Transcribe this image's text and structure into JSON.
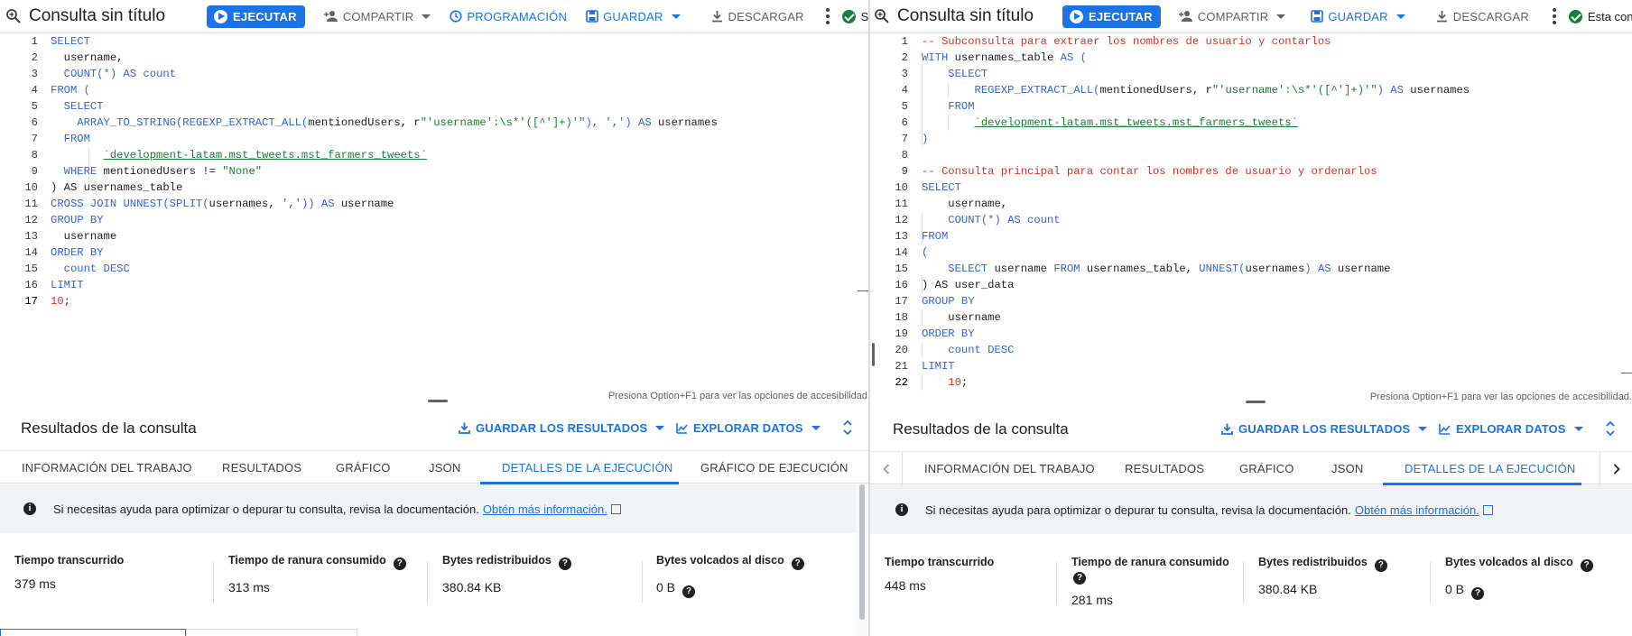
{
  "left": {
    "toolbar": {
      "title": "Consulta sin título",
      "run_label": "EJECUTAR",
      "share_label": "COMPARTIR",
      "schedule_label": "PROGRAMACIÓN",
      "save_label": "GUARDAR",
      "download_label": "DESCARGAR",
      "status_label": "Se c..."
    },
    "line_numbers": [
      "1",
      "2",
      "3",
      "4",
      "5",
      "6",
      "7",
      "8",
      "9",
      "10",
      "11",
      "12",
      "13",
      "14",
      "15",
      "16",
      "17"
    ],
    "accessibility_hint": "Presiona Option+F1 para ver las opciones de accesibilidad.",
    "results": {
      "title": "Resultados de la consulta",
      "save_results_label": "GUARDAR LOS RESULTADOS",
      "explore_label": "EXPLORAR DATOS",
      "tabs": [
        "INFORMACIÓN DEL TRABAJO",
        "RESULTADOS",
        "GRÁFICO",
        "JSON",
        "DETALLES DE LA EJECUCIÓN",
        "GRÁFICO DE EJECUCIÓN"
      ],
      "active_tab": "DETALLES DE LA EJECUCIÓN",
      "info_text": "Si necesitas ayuda para optimizar o depurar tu consulta, revisa la documentación.",
      "info_link": "Obtén más información.",
      "metrics": [
        {
          "label": "Tiempo transcurrido",
          "value": "379 ms"
        },
        {
          "label": "Tiempo de ranura consumido",
          "value": "313 ms"
        },
        {
          "label": "Bytes redistribuidos",
          "value": "380.84 KB"
        },
        {
          "label": "Bytes volcados al disco",
          "value": "0 B"
        }
      ]
    }
  },
  "right": {
    "toolbar": {
      "title": "Consulta sin título",
      "run_label": "EJECUTAR",
      "share_label": "COMPARTIR",
      "save_label": "GUARDAR",
      "download_label": "DESCARGAR",
      "status_label": "Esta con..."
    },
    "line_numbers": [
      "1",
      "2",
      "3",
      "4",
      "5",
      "6",
      "7",
      "8",
      "9",
      "10",
      "11",
      "12",
      "13",
      "14",
      "15",
      "16",
      "17",
      "18",
      "19",
      "20",
      "21",
      "22"
    ],
    "accessibility_hint": "Presiona Option+F1 para ver las opciones de accesibilidad.",
    "results": {
      "title": "Resultados de la consulta",
      "save_results_label": "GUARDAR LOS RESULTADOS",
      "explore_label": "EXPLORAR DATOS",
      "tabs": [
        "INFORMACIÓN DEL TRABAJO",
        "RESULTADOS",
        "GRÁFICO",
        "JSON",
        "DETALLES DE LA EJECUCIÓN"
      ],
      "active_tab": "DETALLES DE LA EJECUCIÓN",
      "info_text": "Si necesitas ayuda para optimizar o depurar tu consulta, revisa la documentación.",
      "info_link": "Obtén más información.",
      "metrics": [
        {
          "label": "Tiempo transcurrido",
          "value": "448 ms"
        },
        {
          "label": "Tiempo de ranura consumido",
          "value": "281 ms"
        },
        {
          "label": "Bytes redistribuidos",
          "value": "380.84 KB"
        },
        {
          "label": "Bytes volcados al disco",
          "value": "0 B"
        }
      ]
    }
  },
  "left_code": {
    "l1_select": "SELECT",
    "l2_username": "username,",
    "l3_count": "COUNT(*)",
    "l3_as": "AS",
    "l3_alias": "count",
    "l4_from": "FROM (",
    "l5_select": "SELECT",
    "l6_array_fn": "ARRAY_TO_STRING(REGEXP_EXTRACT_ALL(",
    "l6_col": "mentionedUsers, r",
    "l6_regex": "\"'username':\\s*'([^']+)'\"",
    "l6_close": "), ",
    "l6_sep": "','",
    "l6_close2": ")",
    "l6_as": "AS",
    "l6_alias": "usernames",
    "l7_from": "FROM",
    "l8_table": "`development-latam.mst_tweets.mst_farmers_tweets`",
    "l9_where": "WHERE",
    "l9_col": "mentionedUsers !=",
    "l9_none": "\"None\"",
    "l10_close": ") AS usernames_table",
    "l11_cross": "CROSS JOIN UNNEST(SPLIT(",
    "l11_arg": "usernames, ",
    "l11_sep": "','",
    "l11_close": ")) AS",
    "l11_alias": "username",
    "l12_group": "GROUP BY",
    "l13_username": "username",
    "l14_order": "ORDER BY",
    "l15_count": "count DESC",
    "l16_limit": "LIMIT",
    "l17_num": "10",
    "l17_semi": ";"
  },
  "right_code": {
    "l1_comment": "-- Subconsulta para extraer los nombres de usuario y contarlos",
    "l2_with": "WITH",
    "l2_table": "usernames_table",
    "l2_as": "AS (",
    "l3_select": "SELECT",
    "l4_fn": "REGEXP_EXTRACT_ALL(",
    "l4_col": "mentionedUsers, r",
    "l4_regex": "\"'username':\\s*'([^']+)'\"",
    "l4_close": ") AS",
    "l4_alias": "usernames",
    "l5_from": "FROM",
    "l6_table": "`development-latam.mst_tweets.mst_farmers_tweets`",
    "l7_close": ")",
    "l9_comment": "-- Consulta principal para contar los nombres de usuario y ordenarlos",
    "l10_select": "SELECT",
    "l11_username": "username,",
    "l12_count": "COUNT(*) AS",
    "l12_alias": "count",
    "l13_from": "FROM",
    "l14_paren": "(",
    "l15_select": "SELECT",
    "l15_col": "username",
    "l15_from": "FROM",
    "l15_table": "usernames_table,",
    "l15_unnest": "UNNEST(",
    "l15_arg": "usernames",
    "l15_close": ") AS",
    "l15_alias": "username",
    "l16_close": ") AS user_data",
    "l17_group": "GROUP BY",
    "l18_username": "username",
    "l19_order": "ORDER BY",
    "l20_count": "count DESC",
    "l21_limit": "LIMIT",
    "l22_num": "10",
    "l22_semi": ";"
  },
  "colors": {
    "accent": "#1a73e8",
    "keyword": "#3367d6",
    "string": "#188038",
    "number": "#d93025",
    "comment": "#d93025",
    "success": "#188038"
  }
}
